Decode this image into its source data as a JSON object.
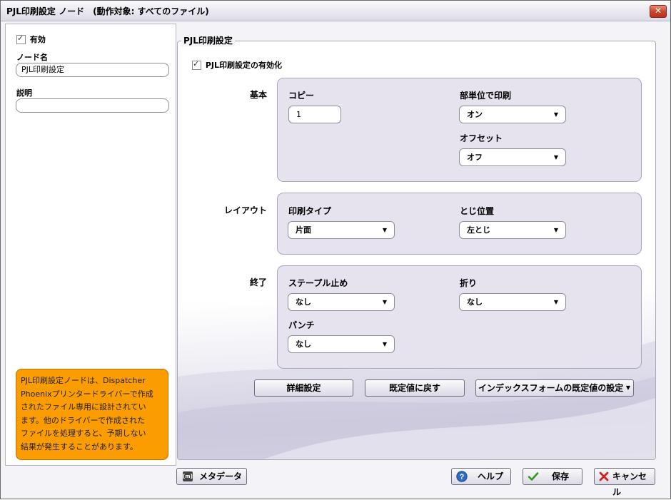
{
  "window": {
    "title": "PJL印刷設定 ノード　(動作対象: すべてのファイル)",
    "close_glyph": "✕"
  },
  "sidebar": {
    "enabled_label": "有効",
    "node_name_label": "ノード名",
    "node_name_value": "PJL印刷設定",
    "description_label": "説明",
    "description_value": "",
    "info_lines": [
      "PJL印刷設定ノードは、Dispatcher",
      "Phoenixプリンタードライバーで作成",
      "されたファイル専用に設計されてい",
      "ます。他のドライバーで作成された",
      "ファイルを処理すると、予期しない",
      "結果が発生することがあります。"
    ],
    "info_color": "#fb9d00"
  },
  "main": {
    "legend": "PJL印刷設定",
    "enable_label": "PJL印刷設定の有効化",
    "basic": {
      "title": "基本",
      "copies_label": "コピー",
      "copies_value": "1",
      "collate_label": "部単位で印刷",
      "collate_value": "オン",
      "offset_label": "オフセット",
      "offset_value": "オフ"
    },
    "layout": {
      "title": "レイアウト",
      "print_type_label": "印刷タイプ",
      "print_type_value": "片面",
      "binding_label": "とじ位置",
      "binding_value": "左とじ"
    },
    "finishing": {
      "title": "終了",
      "staple_label": "ステープル止め",
      "staple_value": "なし",
      "fold_label": "折り",
      "fold_value": "なし",
      "punch_label": "パンチ",
      "punch_value": "なし"
    },
    "buttons": {
      "advanced": "詳細設定",
      "reset_defaults": "既定値に戻す",
      "index_form_defaults": "インデックスフォームの既定値の設定"
    }
  },
  "footer": {
    "metadata_label": "メタデータ",
    "metadata_icon_text": "[m]",
    "help_label": "ヘルプ",
    "save_label": "保存",
    "cancel_label": "キャンセル"
  },
  "colors": {
    "accent_orange": "#fb9d00",
    "group_bg": "#e6e3ef",
    "save_check": "#2e9a1e",
    "cancel_x": "#d2231a",
    "help_blue": "#2f6cc0"
  }
}
